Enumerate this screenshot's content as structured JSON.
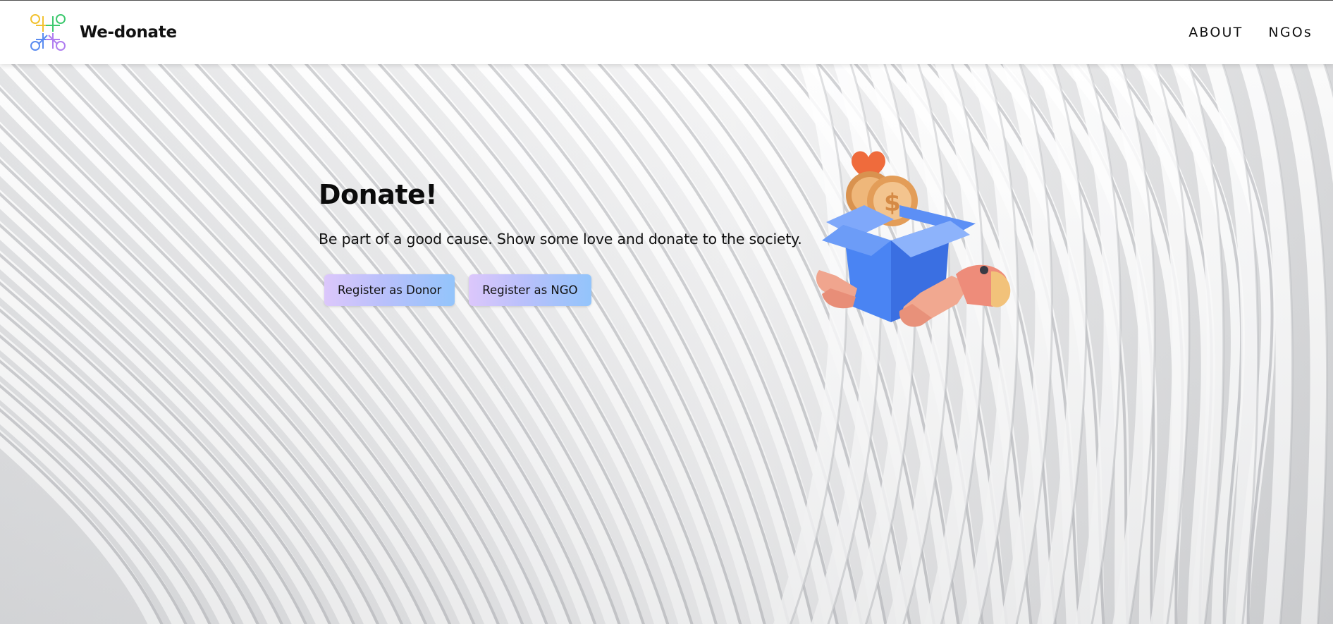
{
  "header": {
    "brand": "We-donate",
    "nav": [
      {
        "label": "ABOUT"
      },
      {
        "label": "NGOs"
      }
    ]
  },
  "hero": {
    "title": "Donate!",
    "subtitle": "Be part of a good cause. Show some love and donate to the society.",
    "buttons": [
      {
        "label": "Register as Donor"
      },
      {
        "label": "Register as NGO"
      }
    ]
  },
  "colors": {
    "button_gradient_start": "#dcc7fb",
    "button_gradient_end": "#93c4fb",
    "box_blue": "#3f7bef",
    "heart": "#ef6b3c",
    "coin": "#e5a766"
  },
  "icons": {
    "logo": "we-donate-logo-icon",
    "illustration": "donation-box-illustration"
  }
}
